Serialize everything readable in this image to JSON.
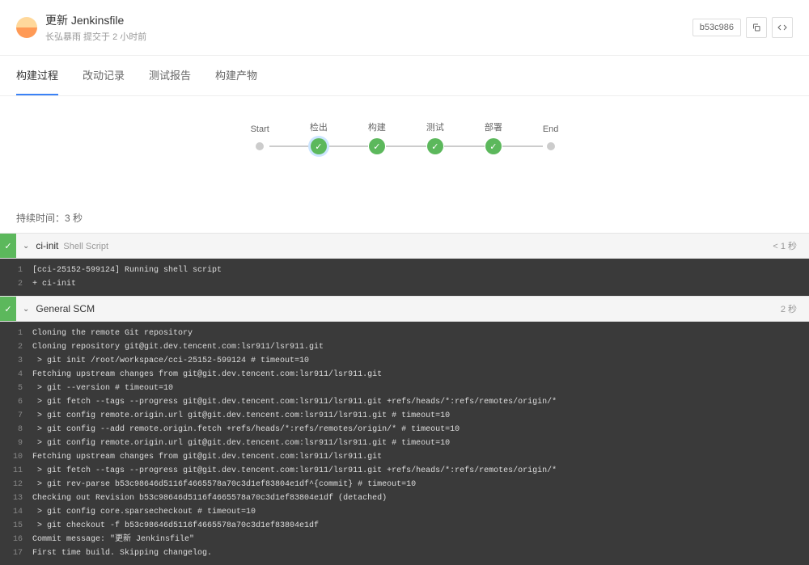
{
  "header": {
    "title": "更新 Jenkinsfile",
    "subtitle": "长弘暴雨 提交于 2 小时前",
    "commit": "b53c986"
  },
  "tabs": [
    {
      "label": "构建过程",
      "active": true
    },
    {
      "label": "改动记录",
      "active": false
    },
    {
      "label": "测试报告",
      "active": false
    },
    {
      "label": "构建产物",
      "active": false
    }
  ],
  "pipeline": {
    "start": "Start",
    "end": "End",
    "stages": [
      {
        "label": "检出",
        "selected": true
      },
      {
        "label": "构建",
        "selected": false
      },
      {
        "label": "测试",
        "selected": false
      },
      {
        "label": "部署",
        "selected": false
      }
    ]
  },
  "duration": "持续时间：3 秒",
  "steps": [
    {
      "name": "ci-init",
      "type": "Shell Script",
      "time": "< 1 秒",
      "lines": [
        "[cci-25152-599124] Running shell script",
        "+ ci-init"
      ]
    },
    {
      "name": "General SCM",
      "type": "",
      "time": "2 秒",
      "lines": [
        "Cloning the remote Git repository",
        "Cloning repository git@git.dev.tencent.com:lsr911/lsr911.git",
        " > git init /root/workspace/cci-25152-599124 # timeout=10",
        "Fetching upstream changes from git@git.dev.tencent.com:lsr911/lsr911.git",
        " > git --version # timeout=10",
        " > git fetch --tags --progress git@git.dev.tencent.com:lsr911/lsr911.git +refs/heads/*:refs/remotes/origin/*",
        " > git config remote.origin.url git@git.dev.tencent.com:lsr911/lsr911.git # timeout=10",
        " > git config --add remote.origin.fetch +refs/heads/*:refs/remotes/origin/* # timeout=10",
        " > git config remote.origin.url git@git.dev.tencent.com:lsr911/lsr911.git # timeout=10",
        "Fetching upstream changes from git@git.dev.tencent.com:lsr911/lsr911.git",
        " > git fetch --tags --progress git@git.dev.tencent.com:lsr911/lsr911.git +refs/heads/*:refs/remotes/origin/*",
        " > git rev-parse b53c98646d5116f4665578a70c3d1ef83804e1df^{commit} # timeout=10",
        "Checking out Revision b53c98646d5116f4665578a70c3d1ef83804e1df (detached)",
        " > git config core.sparsecheckout # timeout=10",
        " > git checkout -f b53c98646d5116f4665578a70c3d1ef83804e1df",
        "Commit message: \"更新 Jenkinsfile\"",
        "First time build. Skipping changelog."
      ]
    }
  ]
}
